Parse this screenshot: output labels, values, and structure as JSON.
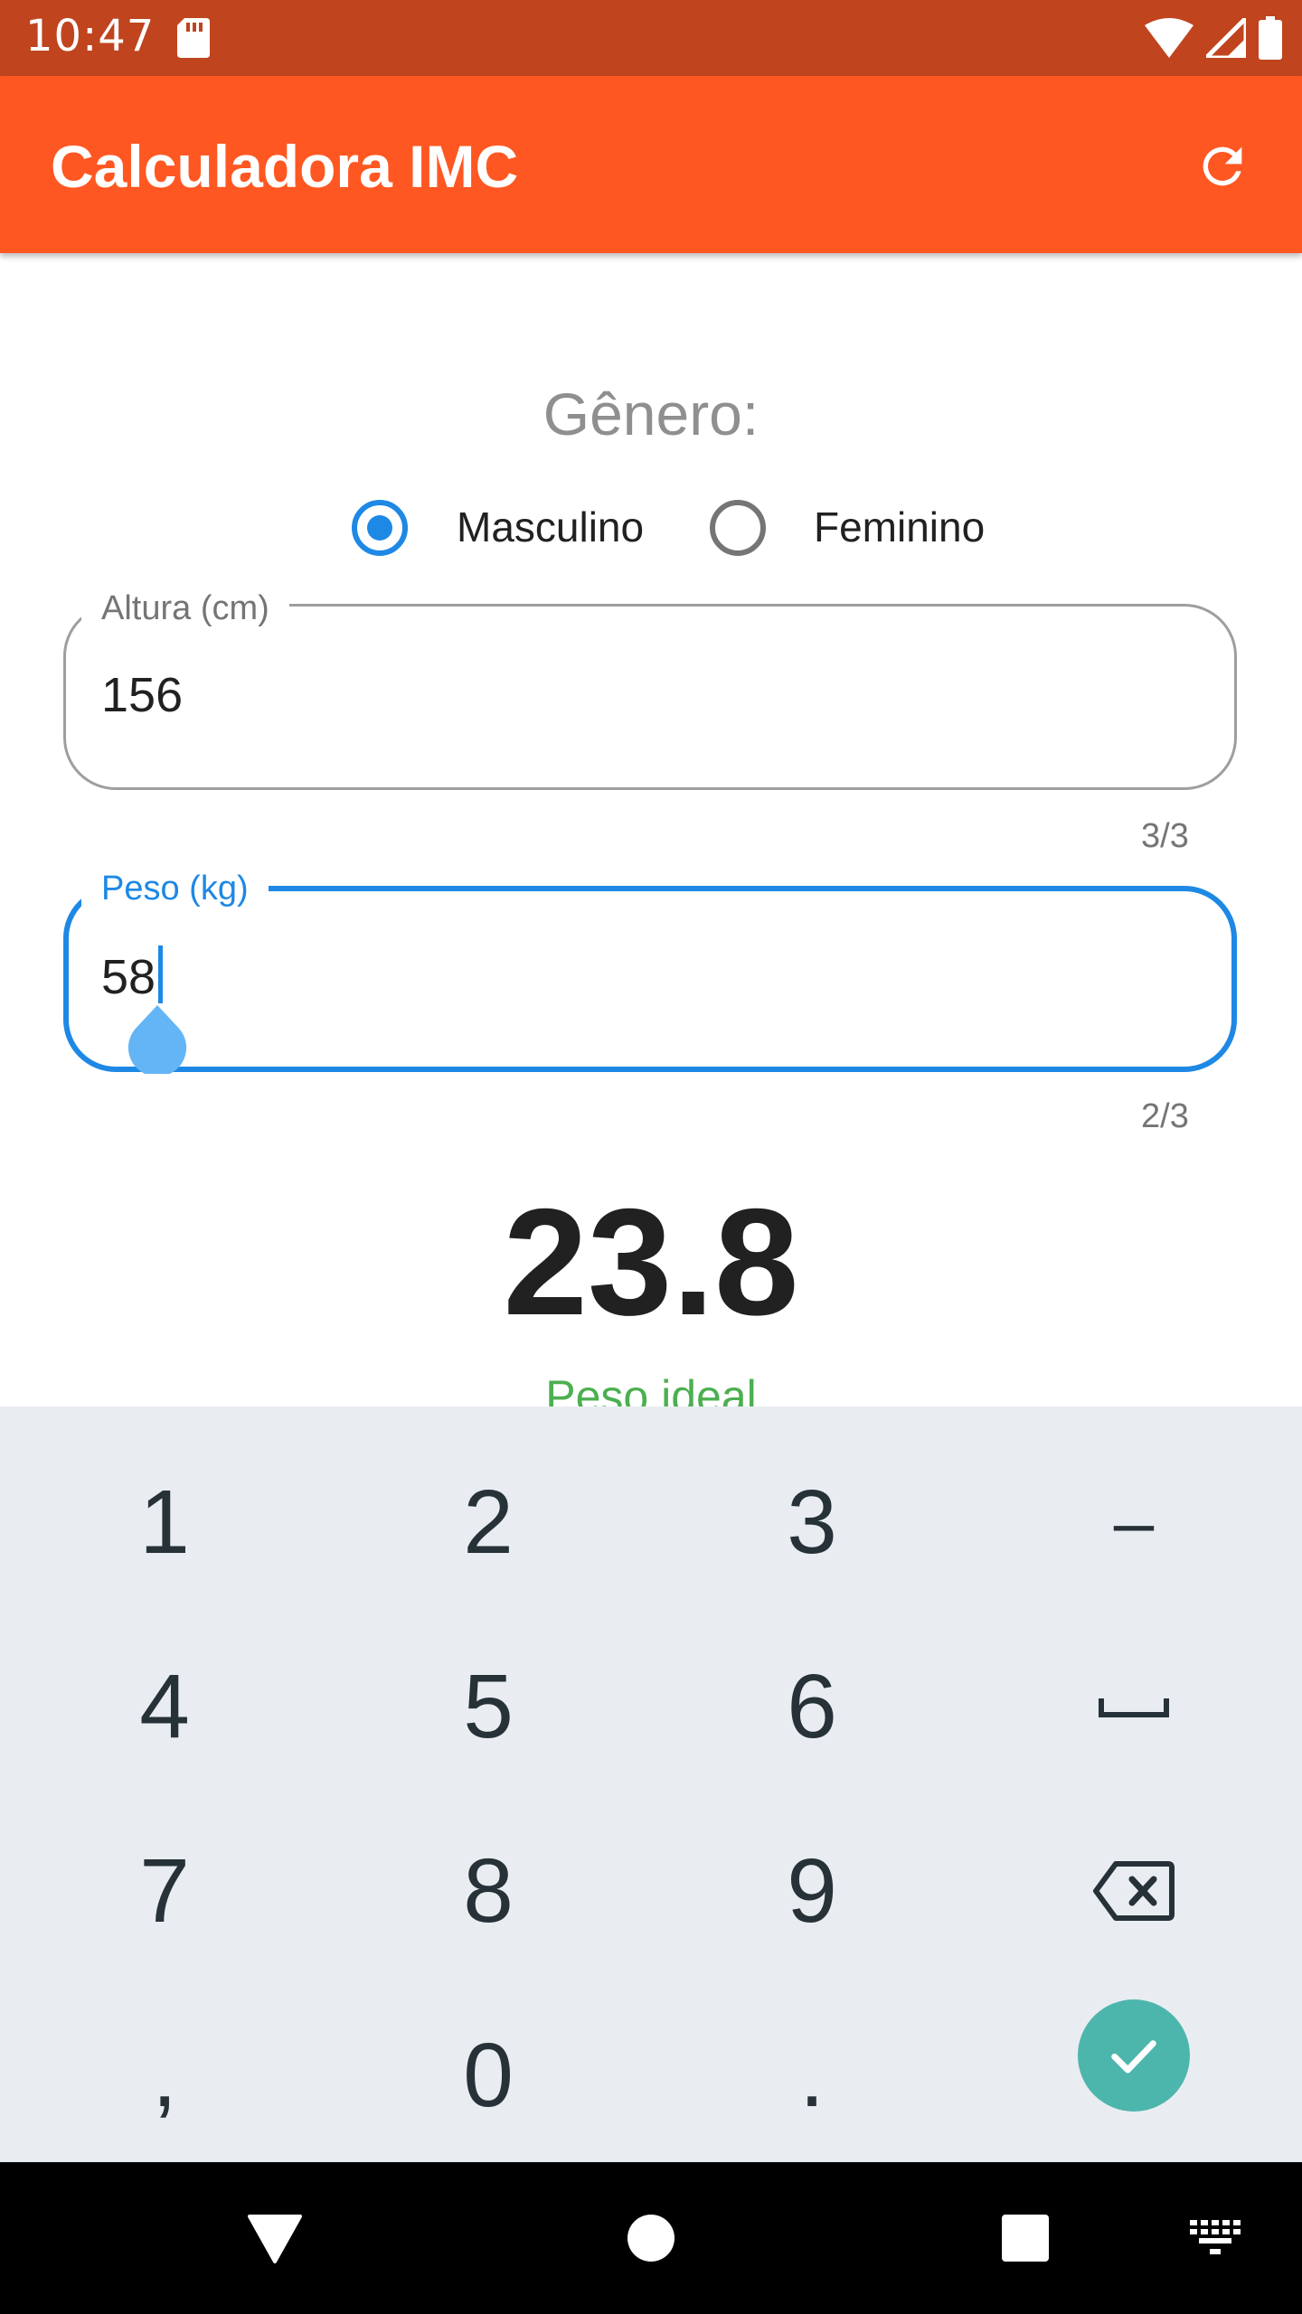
{
  "status_bar": {
    "time": "10:47"
  },
  "app_bar": {
    "title": "Calculadora IMC"
  },
  "gender": {
    "label": "Gênero:",
    "options": [
      {
        "label": "Masculino",
        "selected": true
      },
      {
        "label": "Feminino",
        "selected": false
      }
    ]
  },
  "height_field": {
    "label": "Altura (cm)",
    "value": "156",
    "counter": "3/3"
  },
  "weight_field": {
    "label": "Peso (kg)",
    "value": "58",
    "counter": "2/3"
  },
  "result": {
    "bmi": "23.8",
    "status": "Peso ideal"
  },
  "keyboard": {
    "rows": [
      [
        "1",
        "2",
        "3",
        "–"
      ],
      [
        "4",
        "5",
        "6",
        "space"
      ],
      [
        "7",
        "8",
        "9",
        "backspace"
      ],
      [
        ",",
        "0",
        ".",
        "enter"
      ]
    ]
  },
  "colors": {
    "status_bar": "#c0441e",
    "app_bar": "#ff5722",
    "accent": "#1e88e5",
    "result_ok": "#4caf50",
    "enter_key": "#4db6ac",
    "keyboard_bg": "#e9edf1"
  },
  "icons": [
    "sd-card-icon",
    "wifi-icon",
    "cellular-signal-icon",
    "battery-icon",
    "refresh-icon",
    "space-icon",
    "backspace-icon",
    "check-icon",
    "back-nav-icon",
    "home-nav-icon",
    "recents-nav-icon",
    "keyboard-switch-icon"
  ]
}
